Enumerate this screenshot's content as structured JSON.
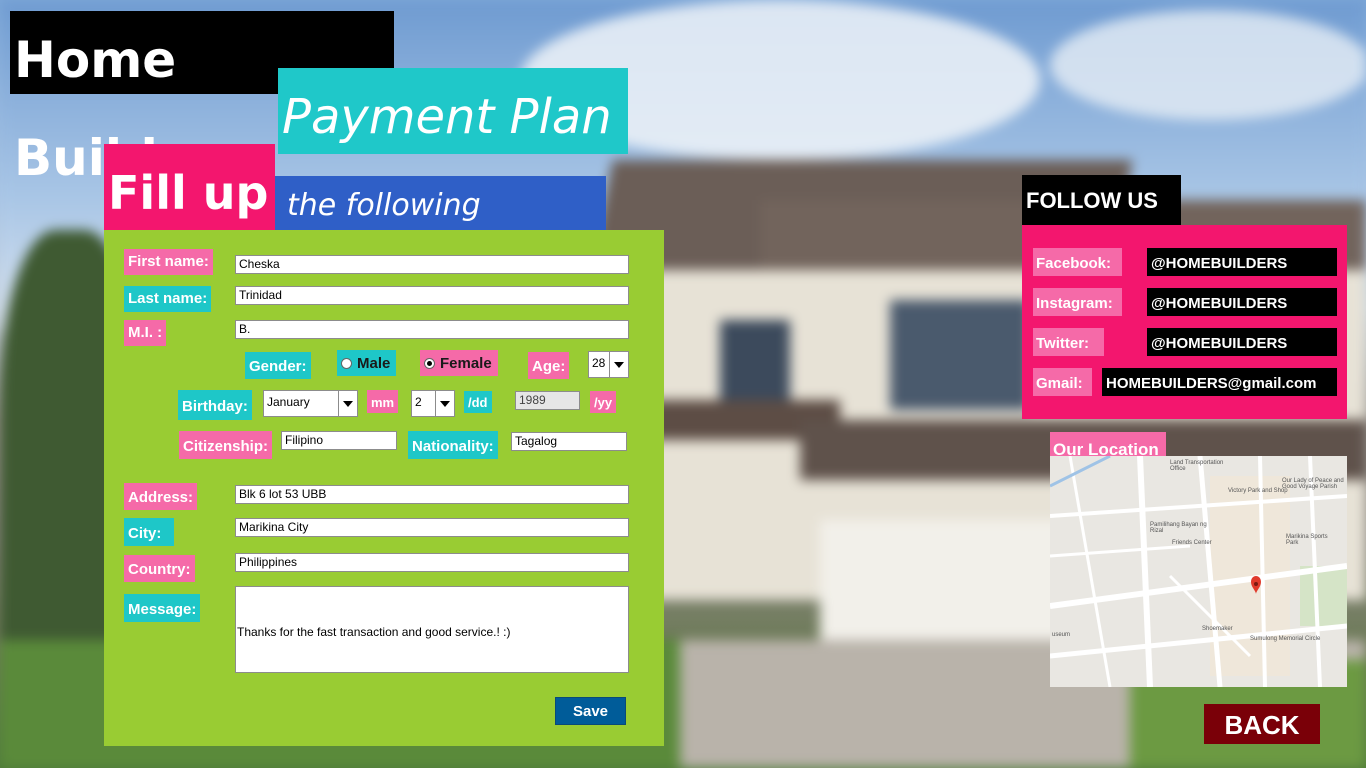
{
  "header": {
    "title": "Home Builders",
    "subtitle": "Payment Plan",
    "fill_up": "Fill up",
    "following": "the following details..."
  },
  "form": {
    "first_name_label": "First name:",
    "first_name_value": "Cheska",
    "last_name_label": "Last name:",
    "last_name_value": "Trinidad",
    "mi_label": "M.I. :",
    "mi_value": "B.",
    "gender_label": "Gender:",
    "gender_male": "Male",
    "gender_female": "Female",
    "gender_selected": "Female",
    "age_label": "Age:",
    "age_value": "28",
    "birthday_label": "Birthday:",
    "birth_month": "January",
    "mm_label": "mm",
    "birth_day": "2",
    "dd_label": "/dd",
    "birth_year": "1989",
    "yy_label": "/yy",
    "citizenship_label": "Citizenship:",
    "citizenship_value": "Filipino",
    "nationality_label": "Nationality:",
    "nationality_value": "Tagalog",
    "address_label": "Address:",
    "address_value": "Blk 6 lot 53 UBB",
    "city_label": "City:",
    "city_value": "Marikina City",
    "country_label": "Country:",
    "country_value": "Philippines",
    "message_label": "Message:",
    "message_value": "Thanks for the fast transaction and good service.! :)",
    "save_label": "Save"
  },
  "follow": {
    "title": "FOLLOW US",
    "items": [
      {
        "label": "Facebook:",
        "value": "@HOMEBUILDERS"
      },
      {
        "label": "Instagram:",
        "value": "@HOMEBUILDERS"
      },
      {
        "label": "Twitter:",
        "value": "@HOMEBUILDERS"
      },
      {
        "label": "Gmail:",
        "value": "HOMEBUILDERS@gmail.com"
      }
    ]
  },
  "location": {
    "title": "Our Location",
    "map_labels": [
      "Land Transportation Office",
      "Victory Park and Shop",
      "Our Lady of Peace and Good Voyage Parish",
      "Pamilihang Bayan ng Rizal",
      "Friends Center",
      "Marikina Sports Park",
      "Shoemaker",
      "Sumulong Memorial Circle",
      "useum"
    ]
  },
  "back_label": "BACK",
  "colors": {
    "pink": "#f3166e",
    "light_pink": "#f56aa8",
    "teal": "#1ec7c8",
    "blue": "#2f5fc7",
    "green": "#99cc33",
    "save_blue": "#005c99",
    "back_red": "#7a0008"
  }
}
